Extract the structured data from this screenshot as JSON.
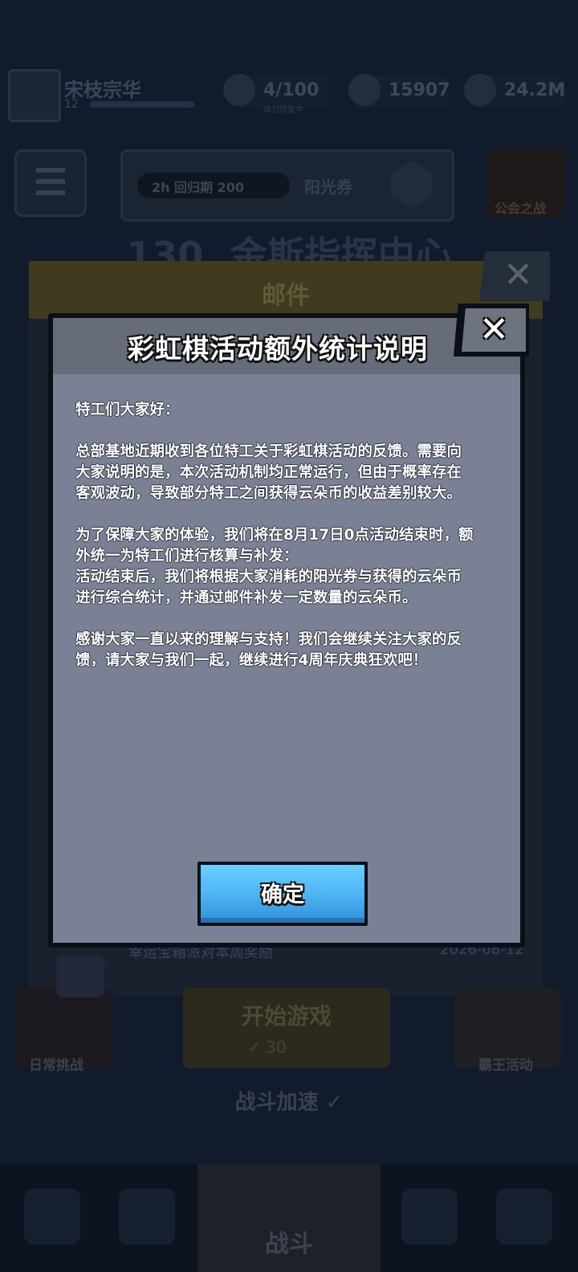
{
  "background": {
    "player": {
      "name": "宋枝宗华",
      "level": "12"
    },
    "resources": [
      {
        "value": "4/100",
        "sub": "体力恢复中"
      },
      {
        "value": "15907",
        "sub": ""
      },
      {
        "value": "24.2M",
        "sub": ""
      }
    ],
    "event_banner": {
      "pill_text": "2h 回归期 200",
      "label": "阳光券"
    },
    "guild_label": "公会之战",
    "stage_title": "130. 金斯指挥中心",
    "daily_label": "日常挑战",
    "play_label": "开始游戏",
    "play_sub": "✓ 30",
    "king_label": "霸王活动",
    "accel_label": "战斗加速 ✓",
    "nav_battle_label": "战斗"
  },
  "mail": {
    "title": "邮件",
    "close_glyph": "✕",
    "row_text": "幸运宝箱派对本周奖励",
    "row_date": "2026-08-12"
  },
  "dialog": {
    "title": "彩虹棋活动额外统计说明",
    "close_glyph": "✕",
    "greeting": "特工们大家好：",
    "p1": [
      "总部基地近期收到各位特工关于彩虹棋活动的反馈。需要向",
      "大家说明的是，本次活动机制均正常运行，但由于概率存在",
      "客观波动，导致部分特工之间获得云朵币的收益差别较大。"
    ],
    "p2": [
      "为了保障大家的体验，我们将在8月17日0点活动结束时，额",
      "外统一为特工们进行核算与补发：",
      "活动结束后，我们将根据大家消耗的阳光券与获得的云朵币",
      "进行综合统计，并通过邮件补发一定数量的云朵币。"
    ],
    "p3": [
      "感谢大家一直以来的理解与支持！我们会继续关注大家的反",
      "馈，请大家与我们一起，继续进行4周年庆典狂欢吧！"
    ],
    "confirm_label": "确定"
  }
}
